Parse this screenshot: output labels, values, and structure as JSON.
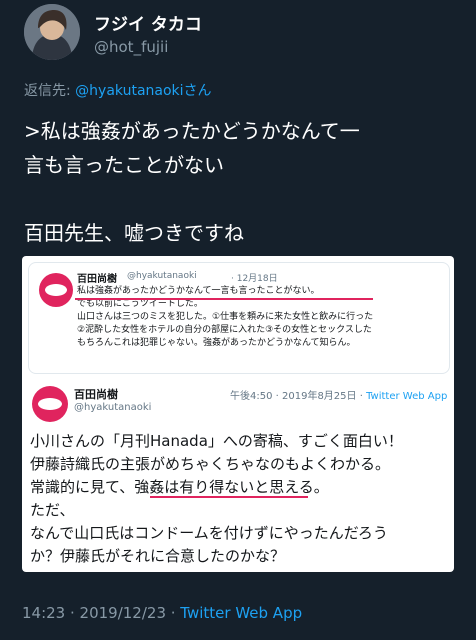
{
  "author": {
    "display_name": "フジイ タカコ",
    "handle": "@hot_fujii"
  },
  "reply": {
    "prefix": "返信先: ",
    "account": "@hyakutanaoki",
    "suffix": "さん"
  },
  "tweet": {
    "text": ">私は強姦があったかどうかなんて一\n言も言ったことがない\n\n百田先生、嘘つきですね"
  },
  "quoted_tweet": {
    "name": "百田尚樹",
    "handle": "@hyakutanaoki",
    "date": "· 12月18日",
    "body": "私は強姦があったかどうかなんて一言も言ったことがない。\nでも以前にこうツイートした。\n山口さんは三つのミスを犯した。①仕事を頼みに来た女性と飲みに行った\n②泥酔した女性をホテルの自分の部屋に入れた③その女性とセックスした\nもちろんこれは犯罪じゃない。強姦があったかどうかなんて知らん。"
  },
  "embedded_tweet": {
    "name": "百田尚樹",
    "handle": "@hyakutanaoki",
    "time": "午後4:50 · 2019年8月25日 · ",
    "source": "Twitter Web App",
    "body": "小川さんの「月刊Hanada」への寄稿、すごく面白い！\n伊藤詩織氏の主張がめちゃくちゃなのもよくわかる。\n常識的に見て、強姦は有り得ないと思える。\nただ、\nなんで山口氏はコンドームを付けずにやったんだろう\nか？伊藤氏がそれに合意したのかな？"
  },
  "footer": {
    "timestamp": "14:23 · 2019/12/23 · ",
    "source": "Twitter Web App"
  },
  "colors": {
    "background": "#15202b",
    "accent": "#1da1f2",
    "underline": "#e0245e"
  }
}
